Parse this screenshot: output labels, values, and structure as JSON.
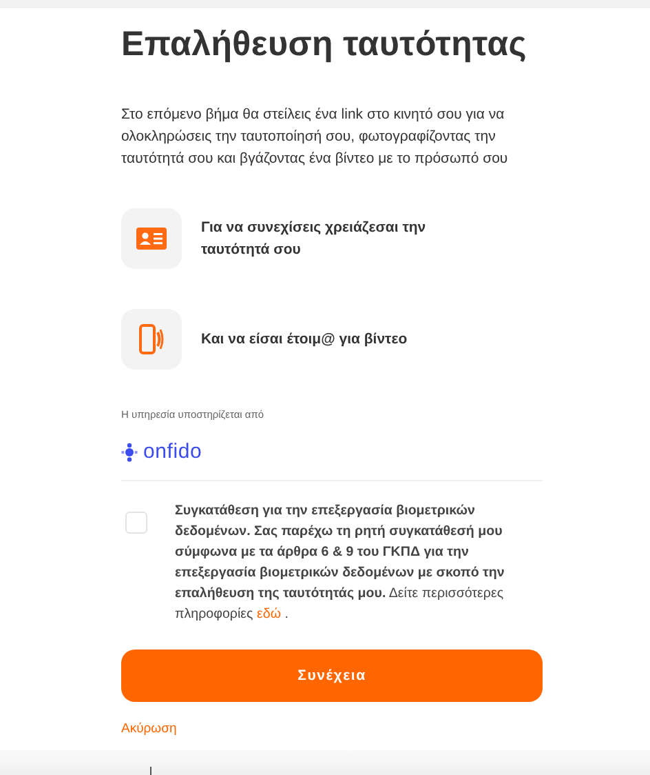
{
  "title": "Επαλήθευση ταυτότητας",
  "intro": "Στο επόμενο βήμα θα στείλεις ένα link στο κινητό σου για να ολοκληρώσεις την ταυτοποίησή σου, φωτογραφίζοντας την ταυτότητά σου και βγάζοντας ένα βίντεο με το πρόσωπό σου",
  "requirements": [
    {
      "kind": "id-card",
      "text": "Για να συνεχίσεις χρειάζεσαι την ταυτότητά σου"
    },
    {
      "kind": "phone",
      "text": "Και να είσαι έτοιμ@ για βίντεο"
    }
  ],
  "provider": {
    "label": "Η υπηρεσία υποστηρίζεται από",
    "logo": "onfido"
  },
  "consent": {
    "checked": false,
    "text": "**Συγκατάθεση για την επεξεργασία βιομετρικών δεδομένων. Σας παρέχω τη ρητή συγκατάθεσή μου σύμφωνα με τα άρθρα 6 & 9 του ΓΚΠΔ για την επεξεργασία βιομετρικών δεδομένων με σκοπό την επαλήθευση της ταυτότητάς μου.** Δείτε περισσότερες πληροφορίες",
    "link": "εδώ",
    "suffix": " ."
  },
  "continue_button": "Συνέχεια",
  "cancel_link": "Ακύρωση"
}
